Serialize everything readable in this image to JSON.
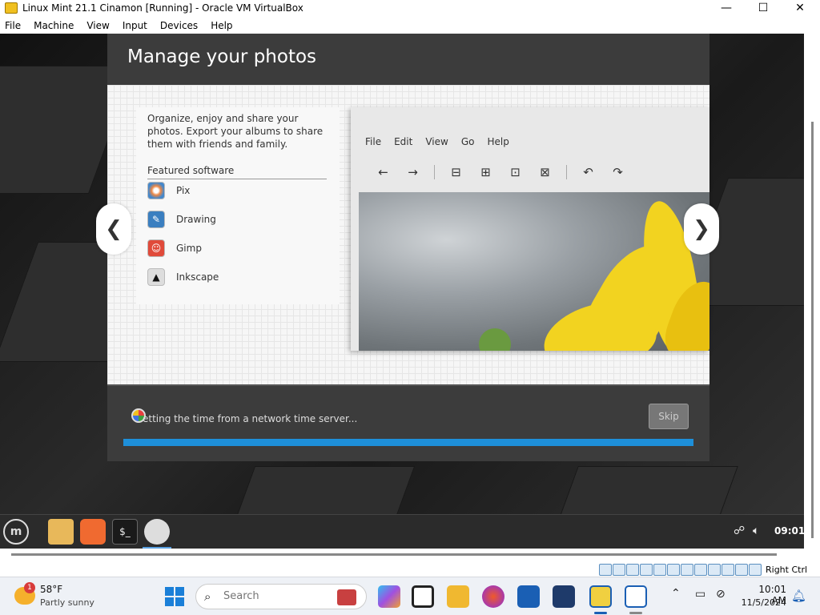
{
  "host_window": {
    "title": "Linux Mint 21.1 Cinamon [Running] - Oracle VM VirtualBox",
    "controls": {
      "minimize": "—",
      "maximize": "☐",
      "close": "✕"
    }
  },
  "menubar": {
    "items": [
      "File",
      "Machine",
      "View",
      "Input",
      "Devices",
      "Help"
    ]
  },
  "dialog": {
    "title": "Manage your photos",
    "description": "Organize, enjoy and share your photos. Export your albums to share them with friends and family.",
    "featured_label": "Featured software",
    "software": [
      {
        "name": "Pix",
        "icon": "pix-icon"
      },
      {
        "name": "Drawing",
        "icon": "drawing-icon"
      },
      {
        "name": "Gimp",
        "icon": "gimp-icon"
      },
      {
        "name": "Inkscape",
        "icon": "inkscape-icon"
      }
    ],
    "nav": {
      "prev": "❮",
      "next": "❯"
    },
    "preview": {
      "menu": [
        "File",
        "Edit",
        "View",
        "Go",
        "Help"
      ],
      "toolbar": [
        "←",
        "→",
        "⊟",
        "⊞",
        "⊡",
        "⊠",
        "↶",
        "↷"
      ]
    },
    "status": "etting the time from a network time server...",
    "skip_label": "Skip",
    "progress_percent": 100,
    "colors": {
      "progress": "#1e8fd9",
      "header": "#3c3c3c"
    }
  },
  "mint_panel": {
    "menu_symbol": "m",
    "terminal_glyph": "$_",
    "clock": "09:01"
  },
  "vbox_status": {
    "right_ctrl": "Right Ctrl"
  },
  "taskbar": {
    "weather": {
      "temp": "58°F",
      "condition": "Partly sunny",
      "badge": "1"
    },
    "search_placeholder": "Search",
    "time": "10:01 AM",
    "date": "11/5/2024"
  }
}
